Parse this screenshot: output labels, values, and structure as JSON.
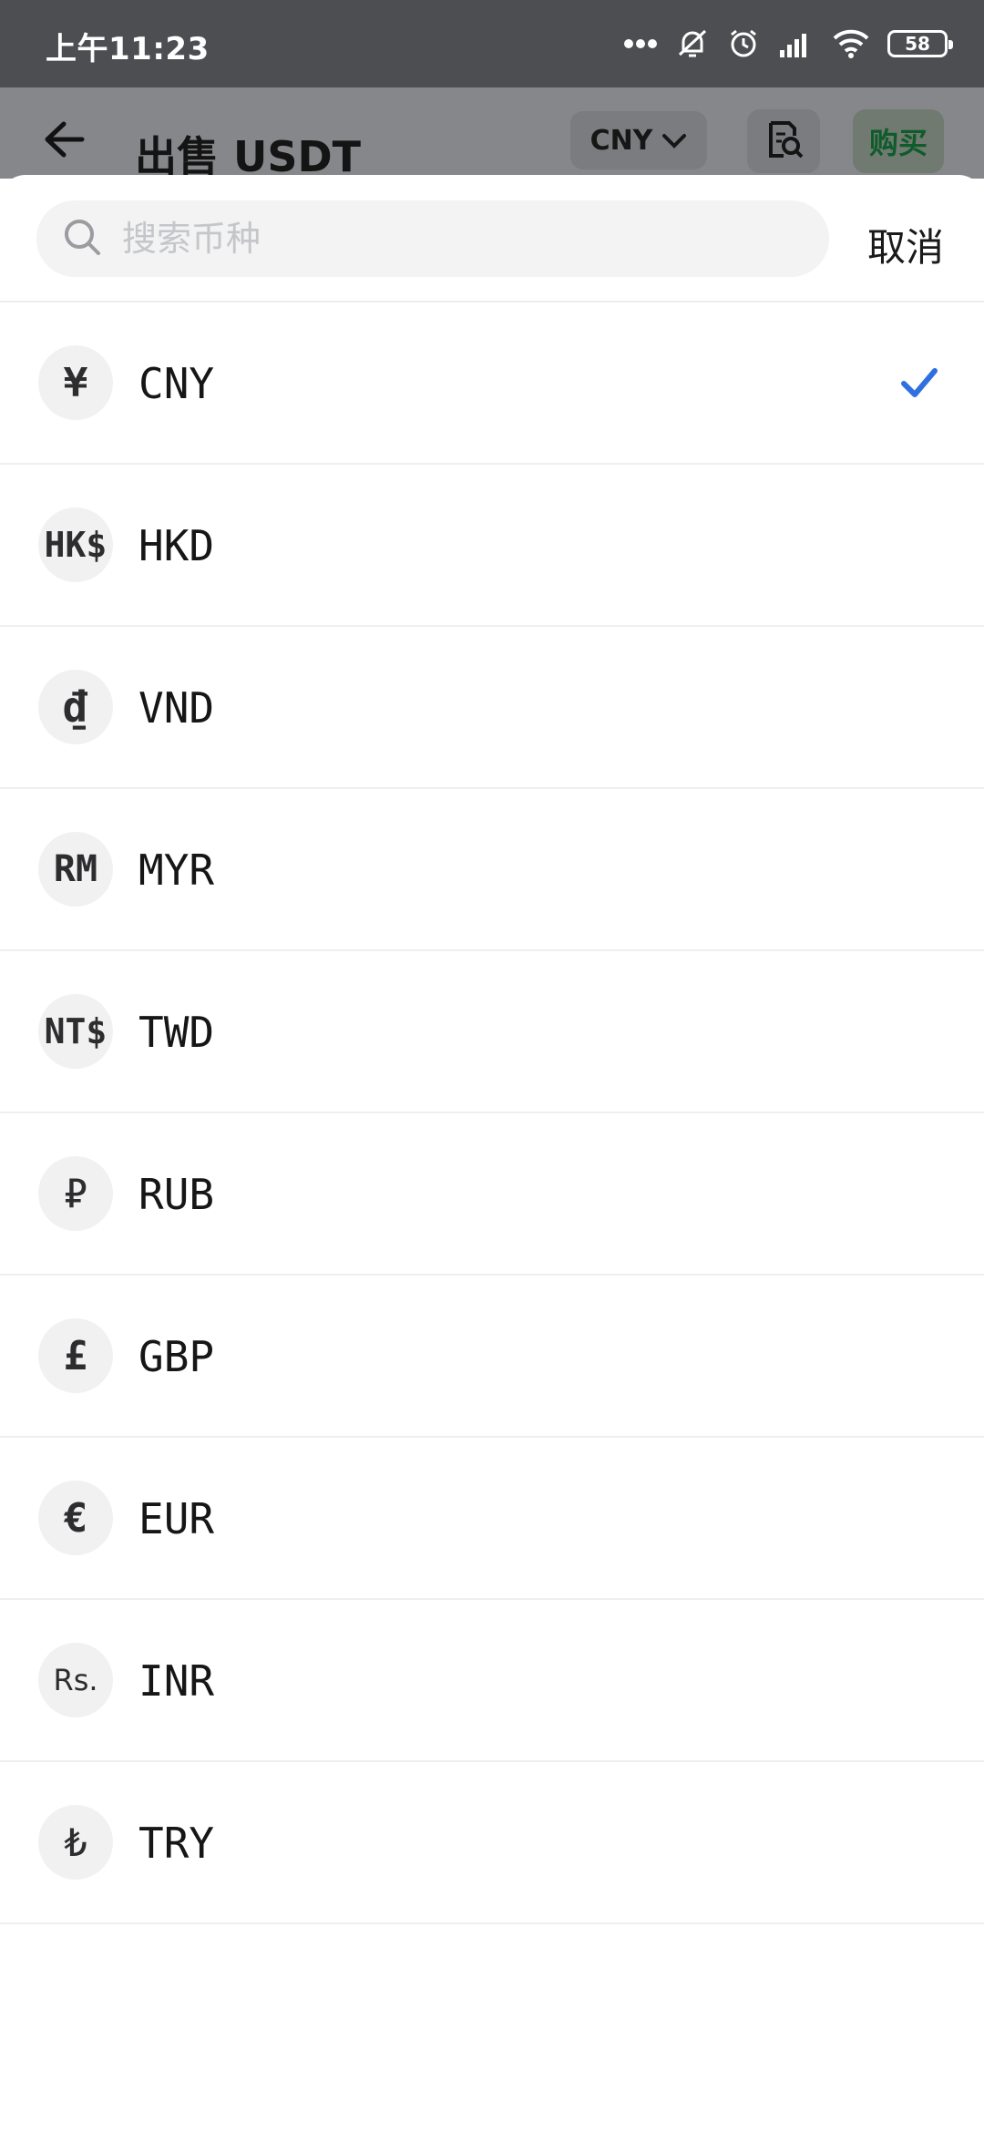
{
  "status_bar": {
    "time": "上午11:23",
    "battery": "58"
  },
  "header": {
    "title": "出售 USDT",
    "currency": "CNY",
    "buy_label": "购买"
  },
  "search": {
    "placeholder": "搜索币种",
    "cancel_label": "取消"
  },
  "currencies": [
    {
      "symbol": "¥",
      "code": "CNY",
      "selected": true
    },
    {
      "symbol": "HK$",
      "code": "HKD"
    },
    {
      "symbol": "₫",
      "code": "VND"
    },
    {
      "symbol": "RM",
      "code": "MYR"
    },
    {
      "symbol": "NT$",
      "code": "TWD"
    },
    {
      "symbol": "₽",
      "code": "RUB"
    },
    {
      "symbol": "£",
      "code": "GBP"
    },
    {
      "symbol": "€",
      "code": "EUR"
    },
    {
      "symbol": "Rs.",
      "code": "INR"
    },
    {
      "symbol": "₺",
      "code": "TRY"
    }
  ],
  "colors": {
    "accent": "#2f6fe0",
    "buy_green": "#0f5b2c"
  }
}
